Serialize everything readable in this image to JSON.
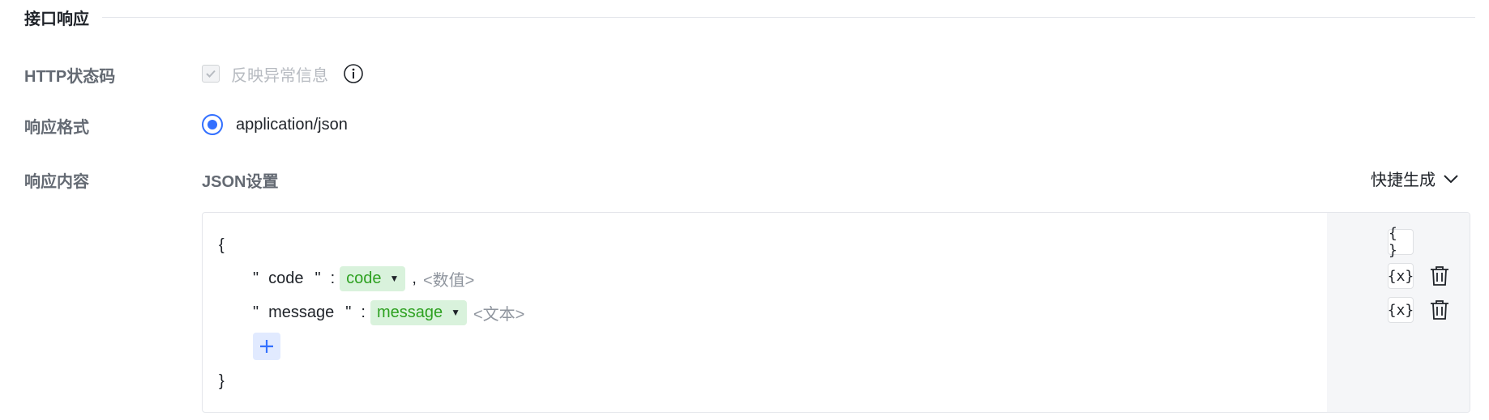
{
  "section": {
    "title": "接口响应"
  },
  "http_status": {
    "label": "HTTP状态码",
    "checkbox_label": "反映异常信息",
    "checked": true,
    "disabled": true
  },
  "response_format": {
    "label": "响应格式",
    "option": "application/json",
    "selected": true
  },
  "response_content": {
    "label": "响应内容",
    "json_title": "JSON设置",
    "quick_generate": "快捷生成"
  },
  "json_editor": {
    "open_brace": "{",
    "close_brace": "}",
    "fields": [
      {
        "quote_open": "\"",
        "key": "code",
        "quote_close": "\"",
        "colon": ":",
        "value": "code",
        "separator": ",",
        "type_hint": "<数值>"
      },
      {
        "quote_open": "\"",
        "key": "message",
        "quote_close": "\"",
        "colon": ":",
        "value": "message",
        "separator": "",
        "type_hint": "<文本>"
      }
    ],
    "add_label": "+",
    "object_button": "{ }",
    "variable_button": "{x}"
  },
  "colors": {
    "accent": "#3370ff",
    "tag_bg": "#d9f2dc",
    "tag_text": "#2ea121",
    "side_bg": "#f5f6f8"
  },
  "icons": [
    "check-icon",
    "info-icon",
    "chevron-down-icon",
    "plus-icon",
    "trash-icon",
    "caret-down-icon"
  ]
}
